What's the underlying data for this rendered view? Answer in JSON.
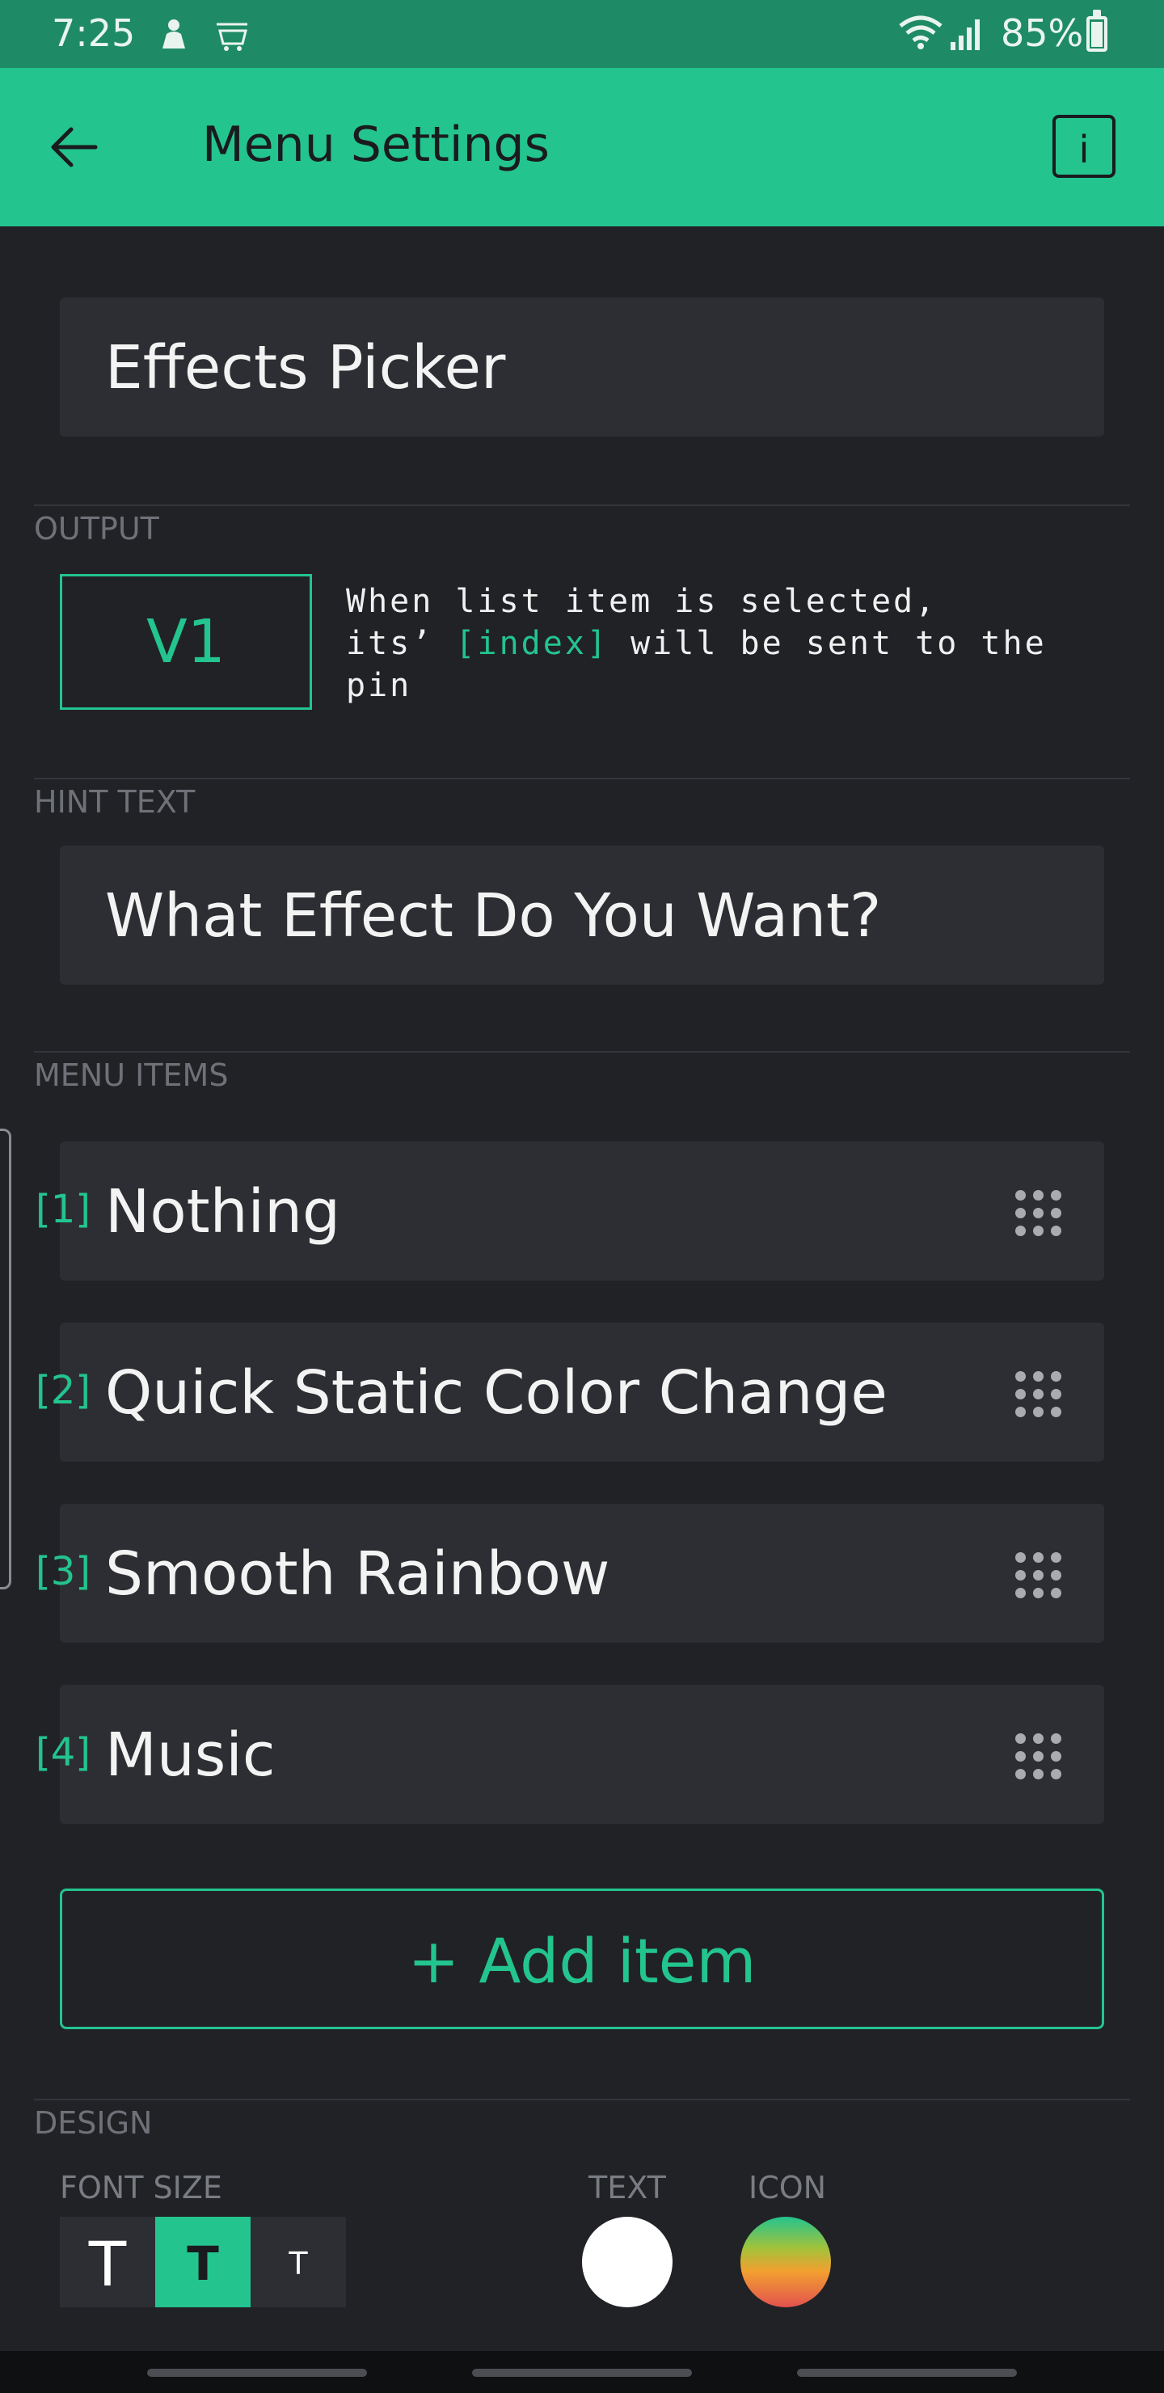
{
  "status_bar": {
    "time": "7:25",
    "battery": "85%",
    "battery_level": 0.85,
    "icons": [
      "notification-person-icon",
      "amazon-cart-icon",
      "wifi-icon",
      "signal-icon",
      "battery-icon"
    ]
  },
  "app_bar": {
    "title": "Menu Settings",
    "back_icon": "arrow-left-icon",
    "info_label": "i",
    "background": "#23c48e"
  },
  "widget_name": "Effects Picker",
  "output": {
    "section_label": "OUTPUT",
    "pin": "V1",
    "description_line1": "When list item is selected,",
    "description_its": "its’",
    "description_index": "[index]",
    "description_rest": "will be sent to the",
    "description_line3": "pin"
  },
  "hint_text": {
    "section_label": "HINT TEXT",
    "value": "What Effect Do You Want?"
  },
  "menu_items": {
    "section_label": "MENU ITEMS",
    "items": [
      {
        "index": "[1]",
        "label": "Nothing"
      },
      {
        "index": "[2]",
        "label": "Quick Static Color Change"
      },
      {
        "index": "[3]",
        "label": "Smooth Rainbow"
      },
      {
        "index": "[4]",
        "label": "Music"
      }
    ],
    "add_label": "+ Add item"
  },
  "design": {
    "section_label": "DESIGN",
    "font_size_label": "FONT SIZE",
    "font_sizes": [
      "T",
      "T",
      "T"
    ],
    "font_size_selected": 1,
    "text_label": "TEXT",
    "icon_label": "ICON",
    "text_color": "#ffffff",
    "accent_color": "#23c48e"
  }
}
